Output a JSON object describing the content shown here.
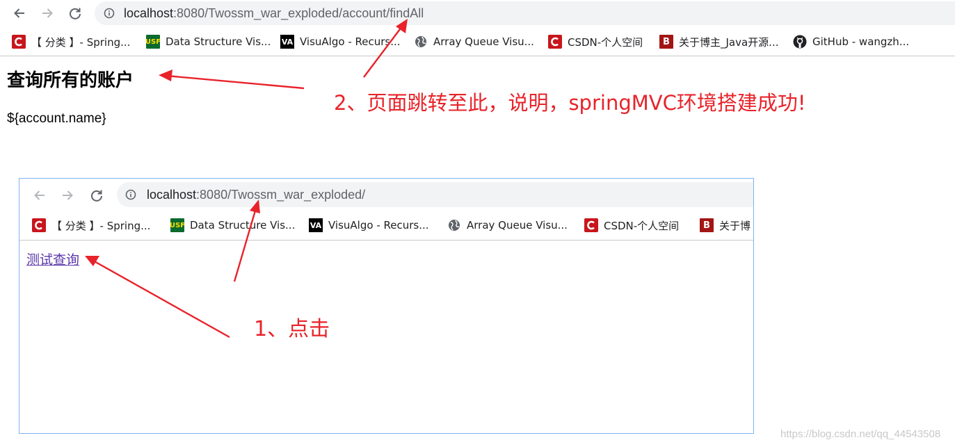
{
  "browser": {
    "url_host": "localhost",
    "url_rest": ":8080/Twossm_war_exploded/account/findAll",
    "bookmarks": [
      {
        "label": "【 分类 】- Spring...",
        "icon": "csdn-icon"
      },
      {
        "label": "Data Structure Vis...",
        "icon": "usf-icon"
      },
      {
        "label": "VisuAlgo - Recurs...",
        "icon": "visualgo-icon"
      },
      {
        "label": "Array Queue Visu...",
        "icon": "globe-icon"
      },
      {
        "label": "CSDN-个人空间",
        "icon": "csdn-icon"
      },
      {
        "label": "关于博主_Java开源...",
        "icon": "blog-b-icon"
      },
      {
        "label": "GitHub - wangzh...",
        "icon": "github-icon"
      }
    ]
  },
  "page": {
    "title": "查询所有的账户",
    "expression": "${account.name}"
  },
  "annotations": {
    "step2": "2、页面跳转至此，说明，springMVC环境搭建成功!",
    "step1": "1、点击"
  },
  "inner": {
    "url_host": "localhost",
    "url_rest": ":8080/Twossm_war_exploded/",
    "bookmarks": [
      {
        "label": "【 分类 】- Spring...",
        "icon": "csdn-icon"
      },
      {
        "label": "Data Structure Vis...",
        "icon": "usf-icon"
      },
      {
        "label": "VisuAlgo - Recurs...",
        "icon": "visualgo-icon"
      },
      {
        "label": "Array Queue Visu...",
        "icon": "globe-icon"
      },
      {
        "label": "CSDN-个人空间",
        "icon": "csdn-icon"
      },
      {
        "label": "关于博",
        "icon": "blog-b-icon"
      }
    ],
    "link": "测试查询"
  },
  "watermark": "https://blog.csdn.net/qq_44543508",
  "colors": {
    "annotation_red": "#e8232a",
    "link_purple": "#5b37a8",
    "csdn_red": "#c8161d"
  }
}
